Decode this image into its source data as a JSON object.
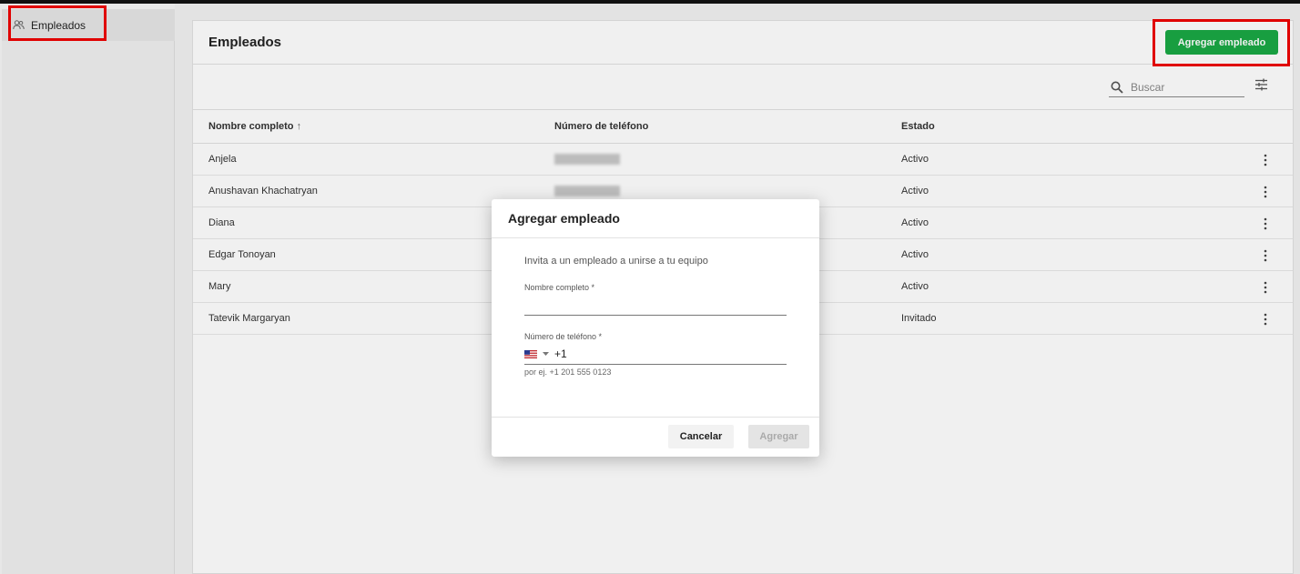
{
  "sidebar": {
    "items": [
      {
        "label": "Empleados",
        "icon": "people-icon"
      }
    ]
  },
  "page": {
    "title": "Empleados",
    "add_button_label": "Agregar empleado"
  },
  "search": {
    "placeholder": "Buscar"
  },
  "table": {
    "columns": [
      "Nombre completo",
      "Número de teléfono",
      "Estado"
    ],
    "sort_indicator": "↑",
    "rows": [
      {
        "name": "Anjela",
        "phone": "",
        "status": "Activo"
      },
      {
        "name": "Anushavan Khachatryan",
        "phone": "",
        "status": "Activo"
      },
      {
        "name": "Diana",
        "phone": "",
        "status": "Activo"
      },
      {
        "name": "Edgar Tonoyan",
        "phone": "",
        "status": "Activo"
      },
      {
        "name": "Mary",
        "phone": "",
        "status": "Activo"
      },
      {
        "name": "Tatevik Margaryan",
        "phone": "",
        "status": "Invitado"
      }
    ]
  },
  "modal": {
    "title": "Agregar empleado",
    "description": "Invita a un empleado a unirse a tu equipo",
    "name_label": "Nombre completo *",
    "name_value": "",
    "phone_label": "Número de teléfono *",
    "country_flag": "us-flag",
    "dial_code": "+1",
    "phone_hint": "por ej. +1 201 555 0123",
    "cancel_label": "Cancelar",
    "submit_label": "Agregar"
  },
  "colors": {
    "primary": "#1aa845",
    "highlight": "#e00000"
  }
}
